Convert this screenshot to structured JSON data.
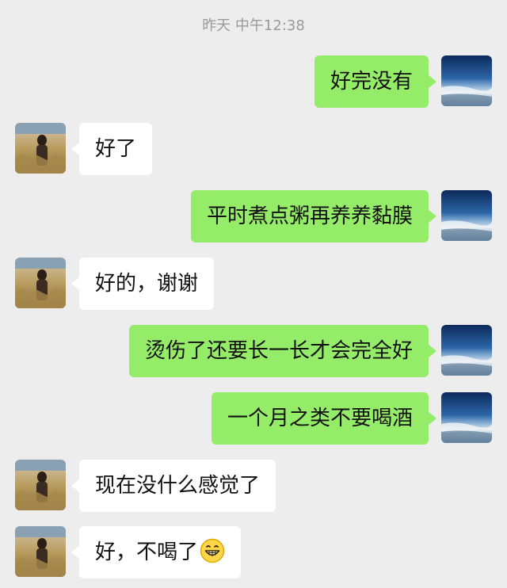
{
  "chat": {
    "timestamp": "昨天 中午12:38",
    "messages": [
      {
        "sender": "me",
        "text": "好完没有"
      },
      {
        "sender": "them",
        "text": "好了"
      },
      {
        "sender": "me",
        "text": "平时煮点粥再养养黏膜"
      },
      {
        "sender": "them",
        "text": "好的，谢谢"
      },
      {
        "sender": "me",
        "text": "烫伤了还要长一长才会完全好"
      },
      {
        "sender": "me",
        "text": "一个月之类不要喝酒"
      },
      {
        "sender": "them",
        "text": "现在没什么感觉了"
      },
      {
        "sender": "them",
        "text": "好，不喝了",
        "emoji": "grinning-emoji"
      }
    ]
  },
  "colors": {
    "background": "#ededed",
    "my_bubble": "#95ec69",
    "their_bubble": "#ffffff",
    "timestamp_text": "#9a9a9a"
  },
  "icons": {
    "my_avatar": "sky-earth-avatar",
    "their_avatar": "field-person-avatar"
  }
}
